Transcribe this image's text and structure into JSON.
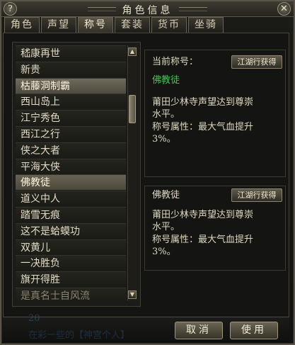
{
  "window": {
    "title": "角色信息",
    "help_label": "?",
    "close_label": "✕"
  },
  "tabs": [
    "角色",
    "声望",
    "称号",
    "套装",
    "货币",
    "坐骑"
  ],
  "active_tab": 2,
  "title_list": [
    "嵇康再世",
    "新贵",
    "枯藤洞制霸",
    "西山岛上",
    "江宁秀色",
    "西江之行",
    "侠之大者",
    "平海大侠",
    "佛教徒",
    "道义中人",
    "踏雪无痕",
    "这不是蛤蟆功",
    "双黄儿",
    "一决胜负",
    "旗开得胜",
    "是真名士自风流"
  ],
  "hovered_index": 2,
  "selected_index": 8,
  "current_title": {
    "label": "当前称号：",
    "button": "江湖行获得",
    "name": "佛教徒",
    "desc_line1": "莆田少林寺声望达到尊崇",
    "desc_line2": "水平。",
    "attr_line1": "称号属性：最大气血提升",
    "attr_line2": "3%。"
  },
  "selected_title": {
    "name": "佛教徒",
    "button": "江湖行获得",
    "desc_line1": "莆田少林寺声望达到尊崇",
    "desc_line2": "水平。",
    "attr_line1": "称号属性：最大气血提升",
    "attr_line2": "3%。"
  },
  "buttons": {
    "cancel": "取消",
    "apply": "使用"
  },
  "background_text": {
    "line1": "20",
    "line2": "在彩一些的【神宫个人】"
  },
  "colors": {
    "accent_green": "#39c94a",
    "frame": "#5a5548"
  }
}
